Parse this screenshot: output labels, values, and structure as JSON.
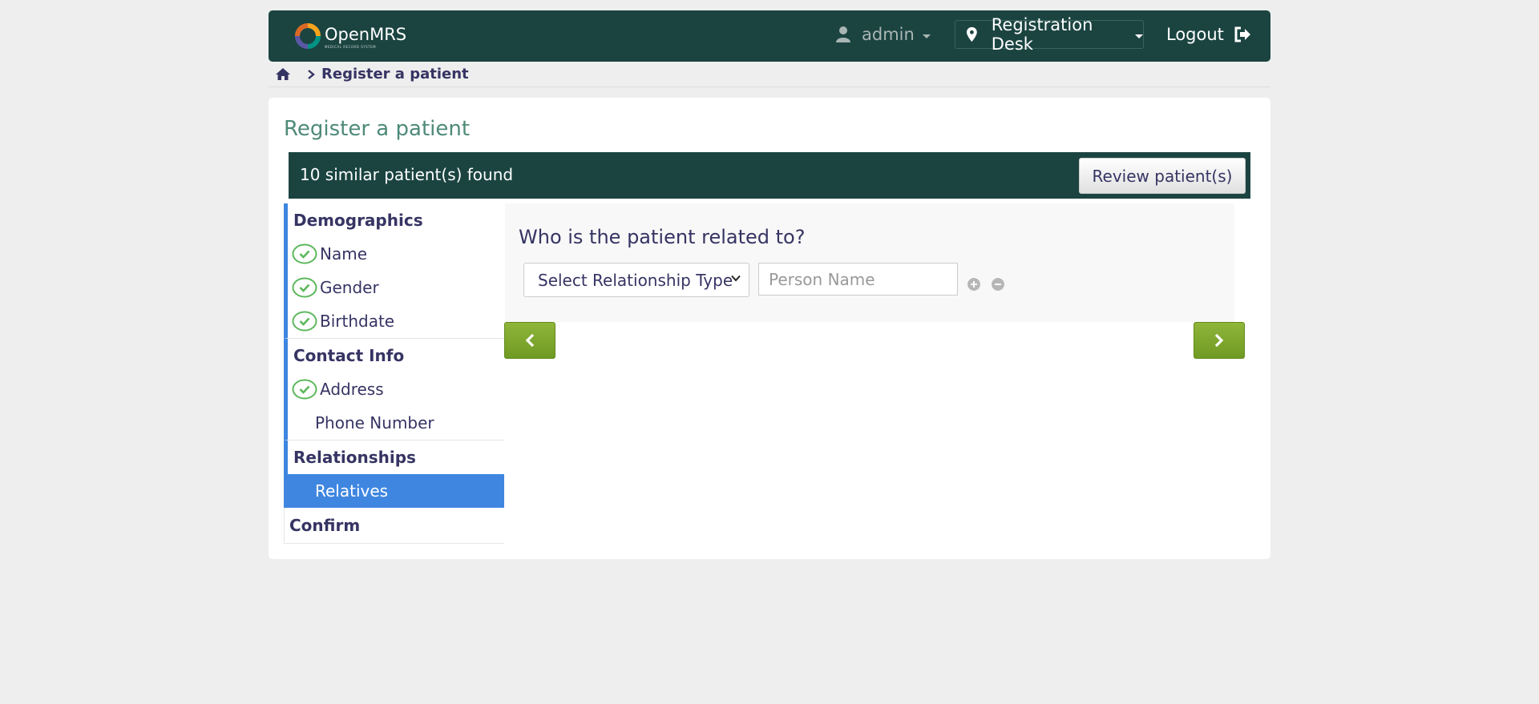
{
  "header": {
    "brand": "OpenMRS",
    "brand_tagline": "MEDICAL RECORD SYSTEM",
    "user": "admin",
    "location": "Registration Desk",
    "logout": "Logout"
  },
  "breadcrumb": {
    "home_icon": "home-icon",
    "current": "Register a patient"
  },
  "page": {
    "title": "Register a patient",
    "similar_text": "10 similar patient(s) found",
    "review_button": "Review patient(s)"
  },
  "sidebar": {
    "demographics": {
      "title": "Demographics",
      "items": [
        {
          "label": "Name",
          "done": true
        },
        {
          "label": "Gender",
          "done": true
        },
        {
          "label": "Birthdate",
          "done": true
        }
      ]
    },
    "contact": {
      "title": "Contact Info",
      "items": [
        {
          "label": "Address",
          "done": true
        },
        {
          "label": "Phone Number",
          "done": false
        }
      ]
    },
    "relationships": {
      "title": "Relationships",
      "items": [
        {
          "label": "Relatives",
          "active": true
        }
      ]
    },
    "confirm": {
      "title": "Confirm"
    }
  },
  "form": {
    "question": "Who is the patient related to?",
    "relationship_select": "Select Relationship Type",
    "person_placeholder": "Person Name"
  },
  "colors": {
    "header_bg": "#1b4441",
    "active_section": "#3e86e0",
    "nav_button": "#7ea52e",
    "check": "#5cb85c"
  }
}
